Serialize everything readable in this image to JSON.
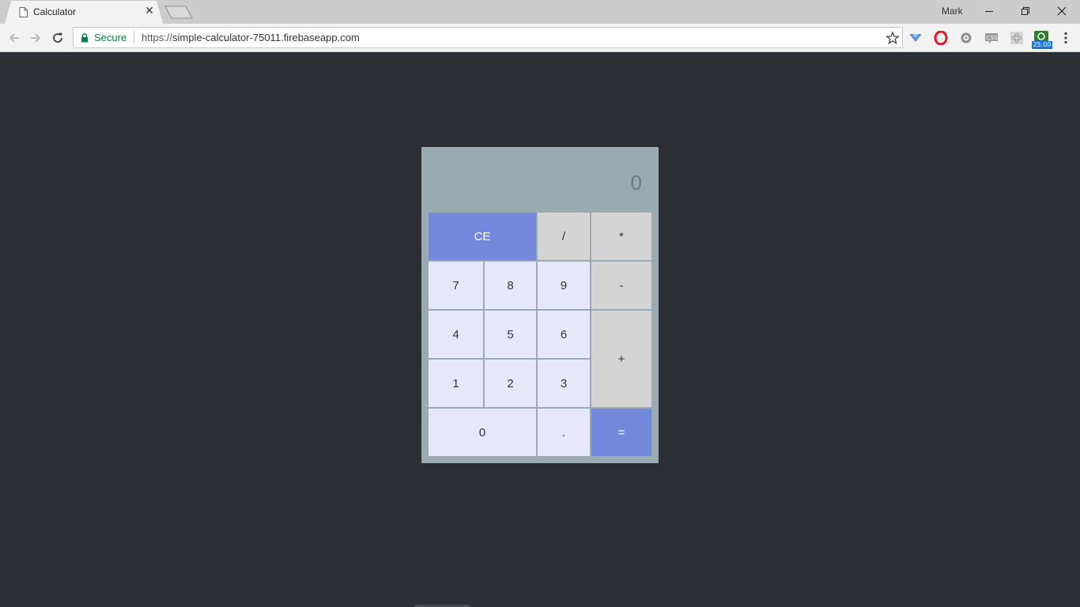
{
  "browser": {
    "tab_title": "Calculator",
    "profile_name": "Mark",
    "secure_label": "Secure",
    "url_protocol": "https://",
    "url_host": "simple-calculator-75011.firebaseapp.com",
    "extension_badge": "25:00"
  },
  "calculator": {
    "display": "0",
    "keys": {
      "clear": "CE",
      "divide": "/",
      "multiply": "*",
      "seven": "7",
      "eight": "8",
      "nine": "9",
      "minus": "-",
      "four": "4",
      "five": "5",
      "six": "6",
      "plus": "+",
      "one": "1",
      "two": "2",
      "three": "3",
      "zero": "0",
      "decimal": ".",
      "equals": "="
    }
  },
  "colors": {
    "page_background": "#2c2f34",
    "calculator_body": "#9aaab3",
    "number_key": "#e6e7f9",
    "operator_key": "#d4d4d4",
    "accent_key": "#7489dc"
  }
}
